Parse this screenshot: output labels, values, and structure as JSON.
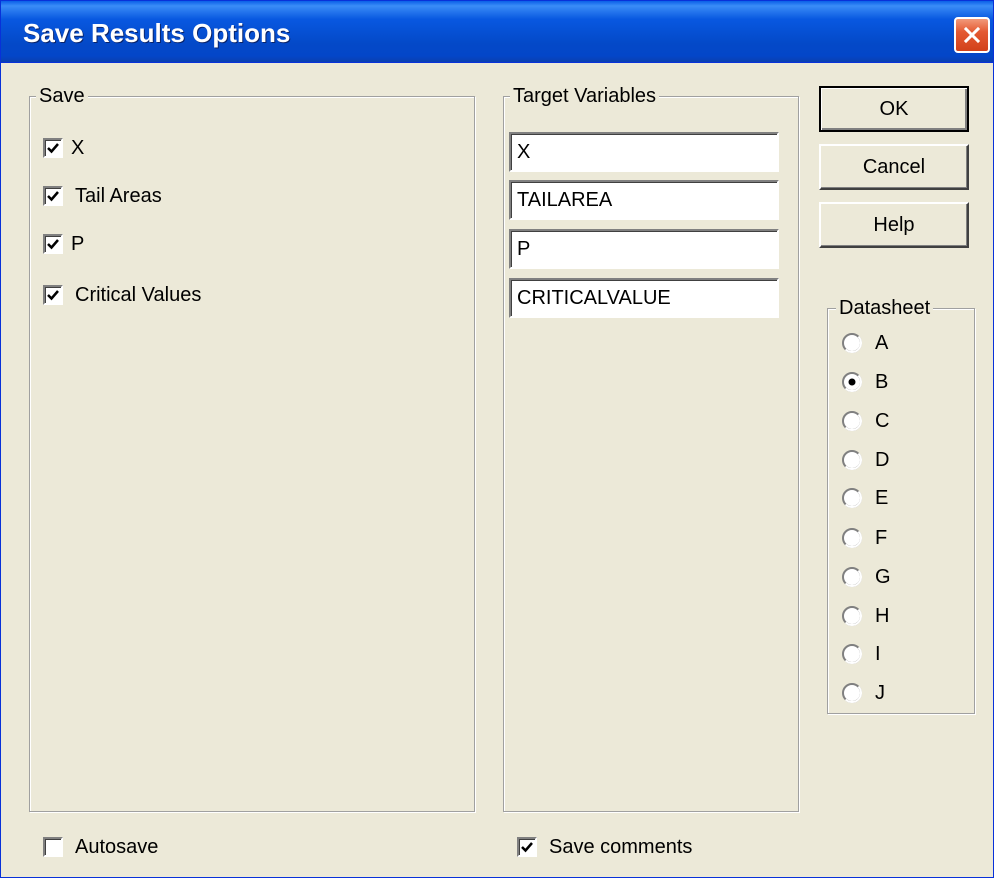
{
  "window": {
    "title": "Save Results Options"
  },
  "save_group": {
    "label": "Save",
    "items": [
      {
        "label": "X",
        "checked": true
      },
      {
        "label": "Tail Areas",
        "checked": true
      },
      {
        "label": "P",
        "checked": true
      },
      {
        "label": "Critical Values",
        "checked": true
      }
    ]
  },
  "target_group": {
    "label": "Target Variables",
    "fields": [
      {
        "value": "X"
      },
      {
        "value": "TAILAREA"
      },
      {
        "value": "P"
      },
      {
        "value": "CRITICALVALUE"
      }
    ]
  },
  "buttons": {
    "ok": "OK",
    "cancel": "Cancel",
    "help": "Help"
  },
  "datasheet_group": {
    "label": "Datasheet",
    "options": [
      "A",
      "B",
      "C",
      "D",
      "E",
      "F",
      "G",
      "H",
      "I",
      "J"
    ],
    "selected": "B"
  },
  "footer": {
    "autosave": {
      "label": "Autosave",
      "checked": false
    },
    "save_comments": {
      "label": "Save comments",
      "checked": true
    }
  },
  "icons": {
    "close": "close-icon",
    "check": "checkmark-icon",
    "radio": "radio-button-icon"
  },
  "colors": {
    "titlebar": "#0449c8",
    "dialog_background": "#ece9d8",
    "close_button": "#e45a32"
  }
}
